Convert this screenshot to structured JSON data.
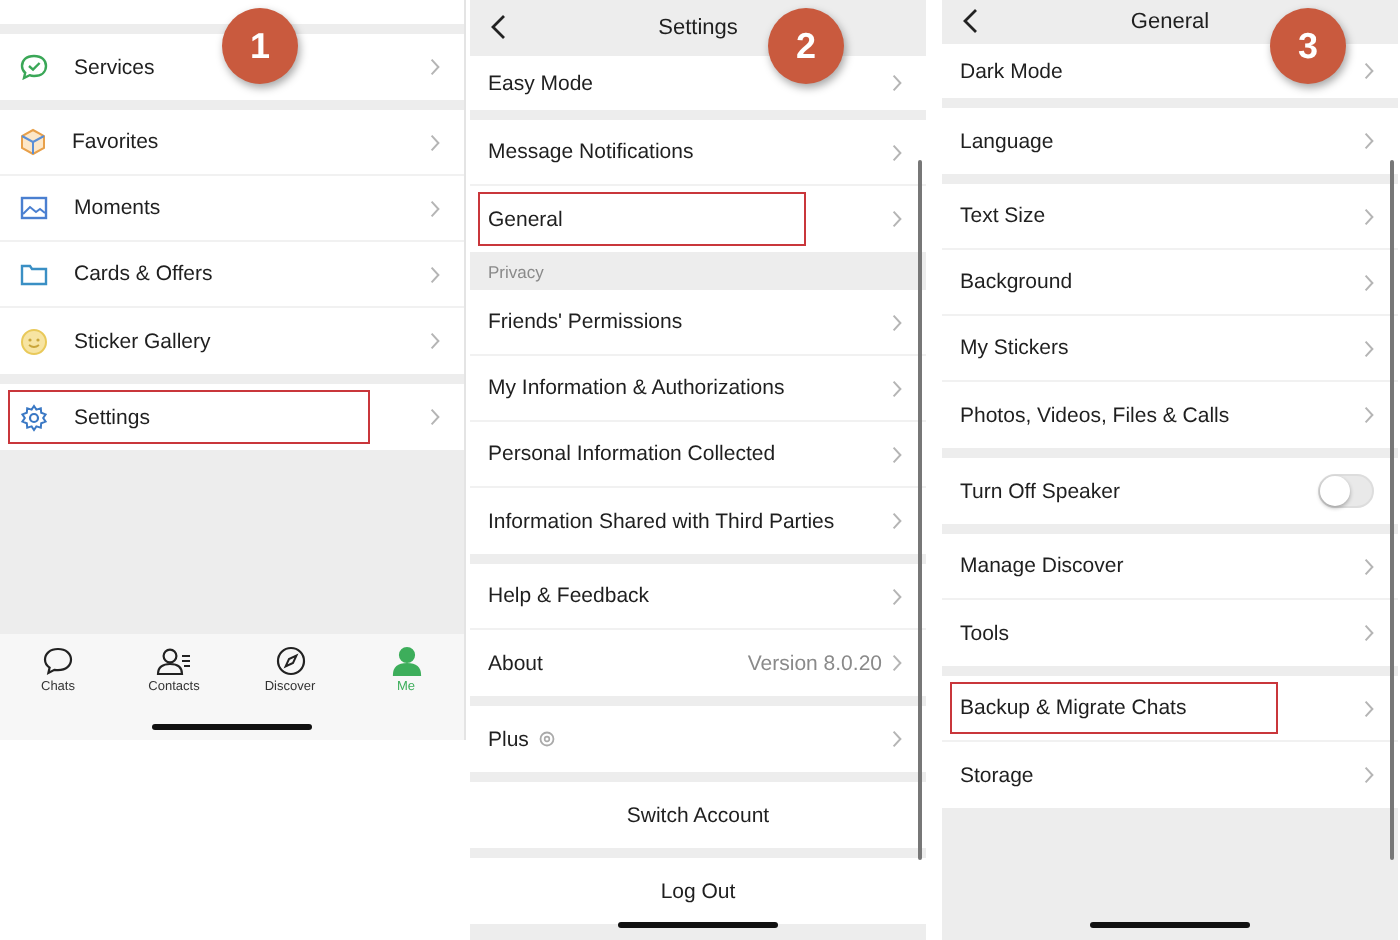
{
  "panels": [
    {
      "kind": "me",
      "badge": "1",
      "groups": [
        {
          "rows": [
            {
              "label": "Services",
              "kind": "link",
              "highlighted": false
            }
          ]
        },
        {
          "rows": [
            {
              "label": "Favorites",
              "kind": "link",
              "highlighted": false
            },
            {
              "label": "Moments",
              "kind": "link",
              "highlighted": false
            },
            {
              "label": "Cards & Offers",
              "kind": "link",
              "highlighted": false
            },
            {
              "label": "Sticker Gallery",
              "kind": "link",
              "highlighted": false
            }
          ]
        },
        {
          "rows": [
            {
              "label": "Settings",
              "kind": "link",
              "highlighted": true
            }
          ]
        }
      ],
      "tab_bar": [
        {
          "label": "Chats",
          "selected": false
        },
        {
          "label": "Contacts",
          "selected": false
        },
        {
          "label": "Discover",
          "selected": false
        },
        {
          "label": "Me",
          "selected": true
        }
      ]
    },
    {
      "kind": "list",
      "badge": "2",
      "title": "Settings",
      "groups": [
        {
          "rows": [
            {
              "label": "Easy Mode",
              "kind": "link",
              "highlighted": false
            }
          ]
        },
        {
          "rows": [
            {
              "label": "Message Notifications",
              "kind": "link",
              "highlighted": false
            },
            {
              "label": "General",
              "kind": "link",
              "highlighted": true
            }
          ]
        },
        {
          "section": "Privacy",
          "rows": [
            {
              "label": "Friends' Permissions",
              "kind": "link",
              "highlighted": false
            },
            {
              "label": "My Information & Authorizations",
              "kind": "link",
              "highlighted": false
            },
            {
              "label": "Personal Information Collected",
              "kind": "link",
              "highlighted": false
            },
            {
              "label": "Information Shared with Third Parties",
              "kind": "link",
              "highlighted": false
            }
          ]
        },
        {
          "rows": [
            {
              "label": "Help & Feedback",
              "kind": "link",
              "highlighted": false
            },
            {
              "label": "About",
              "kind": "link",
              "value": "Version 8.0.20",
              "highlighted": false
            }
          ]
        },
        {
          "rows": [
            {
              "label": "Plus",
              "kind": "plus",
              "highlighted": false
            }
          ]
        },
        {
          "rows": [
            {
              "label": "Switch Account",
              "kind": "button"
            }
          ]
        },
        {
          "rows": [
            {
              "label": "Log Out",
              "kind": "button"
            }
          ]
        }
      ]
    },
    {
      "kind": "list",
      "badge": "3",
      "title": "General",
      "groups": [
        {
          "rows": [
            {
              "label": "Dark Mode",
              "kind": "link",
              "highlighted": false
            }
          ]
        },
        {
          "rows": [
            {
              "label": "Language",
              "kind": "link",
              "highlighted": false
            }
          ]
        },
        {
          "rows": [
            {
              "label": "Text Size",
              "kind": "link",
              "highlighted": false
            },
            {
              "label": "Background",
              "kind": "link",
              "highlighted": false
            },
            {
              "label": "My Stickers",
              "kind": "link",
              "highlighted": false
            },
            {
              "label": "Photos, Videos, Files & Calls",
              "kind": "link",
              "highlighted": false
            }
          ]
        },
        {
          "rows": [
            {
              "label": "Turn Off Speaker",
              "kind": "toggle",
              "on": false,
              "highlighted": false
            }
          ]
        },
        {
          "rows": [
            {
              "label": "Manage Discover",
              "kind": "link",
              "highlighted": false
            },
            {
              "label": "Tools",
              "kind": "link",
              "highlighted": false
            }
          ]
        },
        {
          "rows": [
            {
              "label": "Backup & Migrate Chats",
              "kind": "link",
              "highlighted": true
            },
            {
              "label": "Storage",
              "kind": "link",
              "highlighted": false
            }
          ]
        }
      ]
    }
  ]
}
